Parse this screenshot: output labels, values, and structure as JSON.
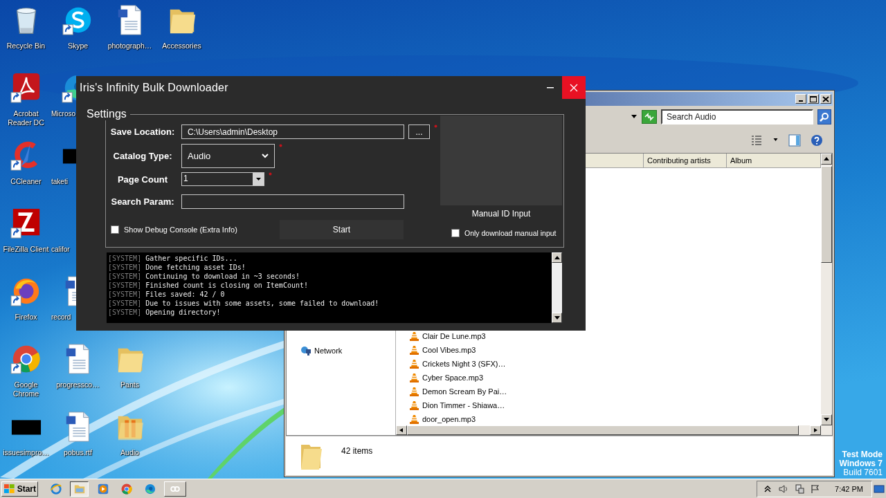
{
  "desktop": {
    "icons": [
      {
        "label": "Recycle Bin",
        "kind": "recycle-bin",
        "shortcut": false
      },
      {
        "label": "Acrobat Reader DC",
        "kind": "acrobat",
        "shortcut": true
      },
      {
        "label": "CCleaner",
        "kind": "ccleaner",
        "shortcut": true
      },
      {
        "label": "FileZilla Client",
        "kind": "filezilla",
        "shortcut": true
      },
      {
        "label": "Firefox",
        "kind": "firefox",
        "shortcut": true
      },
      {
        "label": "Google Chrome",
        "kind": "chrome",
        "shortcut": true
      },
      {
        "label": "issuesimpro…",
        "kind": "thumbnail",
        "shortcut": false
      },
      {
        "label": "Skype",
        "kind": "skype",
        "shortcut": true
      },
      {
        "label": "Microso",
        "kind": "edge",
        "shortcut": true,
        "clipped": true
      },
      {
        "label": "taketi",
        "kind": "thumbnail",
        "shortcut": false,
        "clipped": true
      },
      {
        "label": "califor",
        "clipped": true
      },
      {
        "label": "record",
        "kind": "document",
        "shortcut": false,
        "clipped": true
      },
      {
        "label": "progressco…",
        "kind": "document",
        "shortcut": false
      },
      {
        "label": "pobus.rtf",
        "kind": "document",
        "shortcut": false
      },
      {
        "label": "photograph…",
        "kind": "document",
        "shortcut": false
      },
      {
        "label": "Pants",
        "kind": "folder",
        "shortcut": false
      },
      {
        "label": "Audio",
        "kind": "music-folder",
        "shortcut": false
      },
      {
        "label": "Accessories",
        "kind": "folder",
        "shortcut": false
      }
    ],
    "os_notice": [
      "Test Mode",
      "Windows 7",
      "Build 7601"
    ]
  },
  "explorer": {
    "search": {
      "placeholder": "Search Audio"
    },
    "columns": [
      "Contributing artists",
      "Album"
    ],
    "nav": [
      {
        "label": "Network",
        "kind": "network"
      }
    ],
    "files": [
      "Clair De Lune.mp3",
      "Cool Vibes.mp3",
      "Crickets Night 3 (SFX)…",
      "Cyber Space.mp3",
      "Demon Scream By Pai…",
      "Dion Timmer - Shiawa…",
      "door_open.mp3"
    ],
    "status": "42 items"
  },
  "app": {
    "title": "Iris's Infinity Bulk Downloader",
    "settings": {
      "title": "Settings",
      "save_location": {
        "label": "Save Location:",
        "value": "C:\\Users\\admin\\Desktop",
        "browse": "...",
        "required": true
      },
      "catalog_type": {
        "label": "Catalog Type:",
        "value": "Audio",
        "required": true
      },
      "page_count": {
        "label": "Page Count",
        "value": "1",
        "required": true
      },
      "search_param": {
        "label": "Search Param:"
      },
      "debug_console": {
        "label": "Show Debug Console (Extra Info)",
        "checked": false
      },
      "start": "Start",
      "manual_input": {
        "label": "Manual ID Input"
      },
      "only_manual": {
        "label": "Only download manual input",
        "checked": false
      }
    },
    "console": [
      {
        "tag": "[SYSTEM]",
        "text": "Gather specific IDs..."
      },
      {
        "tag": "[SYSTEM]",
        "text": "Done fetching asset IDs!"
      },
      {
        "tag": "[SYSTEM]",
        "text": "Continuing to download in ~3 seconds!"
      },
      {
        "tag": "[SYSTEM]",
        "text": "Finished count is closing on ItemCount!"
      },
      {
        "tag": "[SYSTEM]",
        "text": "Files saved: 42 / 0"
      },
      {
        "tag": "[SYSTEM]",
        "text": "Due to issues with some assets, some failed to download!"
      },
      {
        "tag": "[SYSTEM]",
        "text": "Opening directory!"
      }
    ]
  },
  "taskbar": {
    "start": "Start",
    "buttons": [
      {
        "kind": "ie",
        "selected": false
      },
      {
        "kind": "explorer",
        "selected": true
      },
      {
        "kind": "media",
        "selected": false
      },
      {
        "kind": "chrome",
        "selected": false
      },
      {
        "kind": "edge",
        "selected": false
      },
      {
        "kind": "program",
        "selected": false
      }
    ],
    "clock": "7:42 PM"
  }
}
